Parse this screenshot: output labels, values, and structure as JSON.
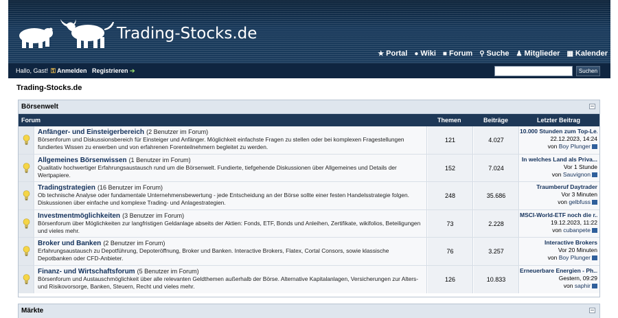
{
  "header": {
    "site_title": "Trading-Stocks.de",
    "menu": [
      {
        "label": "Portal",
        "icon": "portal-icon",
        "glyph": "★"
      },
      {
        "label": "Wiki",
        "icon": "wiki-icon",
        "glyph": "●"
      },
      {
        "label": "Forum",
        "icon": "forum-icon",
        "glyph": "■"
      },
      {
        "label": "Suche",
        "icon": "search-icon",
        "glyph": "⚲"
      },
      {
        "label": "Mitglieder",
        "icon": "members-icon",
        "glyph": "♟"
      },
      {
        "label": "Kalender",
        "icon": "calendar-icon",
        "glyph": "▦"
      }
    ]
  },
  "userbar": {
    "greeting": "Hallo, Gast!",
    "login": "Anmelden",
    "register": "Registrieren",
    "search_placeholder": "",
    "search_button": "Suchen"
  },
  "breadcrumb": "Trading-Stocks.de",
  "category": {
    "title": "Börsenwelt",
    "columns": {
      "forum": "Forum",
      "themen": "Themen",
      "beitraege": "Beiträge",
      "last": "Letzter Beitrag"
    },
    "forums": [
      {
        "title": "Anfänger- und Einsteigerbereich",
        "users": "(2 Benutzer im Forum)",
        "desc": "Börsenforum und Diskussionsbereich für Einsteiger und Anfänger. Möglichkeit einfachste Fragen zu stellen oder bei komplexen Fragestellungen fundiertes Wissen zu erwerben und von erfahrenen Forenteilnehmern begleitet zu werden.",
        "themen": "121",
        "beitraege": "4.027",
        "last_title": "10.000 Stunden zum Top-Le...",
        "last_time": "22.12.2023, 14:24",
        "last_by": "von",
        "last_user": "Boy Plunger"
      },
      {
        "title": "Allgemeines Börsenwissen",
        "users": "(1 Benutzer im Forum)",
        "desc": "Qualitativ hochwertiger Erfahrungsaustausch rund um die Börsenwelt. Fundierte, tiefgehende Diskussionen über Allgemeines und Details der Wertpapiere.",
        "themen": "152",
        "beitraege": "7.024",
        "last_title": "In welches Land als Priva...",
        "last_time": "Vor 1 Stunde",
        "last_by": "von",
        "last_user": "Sauvignon"
      },
      {
        "title": "Tradingstrategien",
        "users": "(16 Benutzer im Forum)",
        "desc": "Ob technische Analyse oder fundamentale Unternehmensbewertung - jede Entscheidung an der Börse sollte einer festen Handelsstrategie folgen. Diskussionen über einfache und komplexe Trading- und Anlagestrategien.",
        "themen": "248",
        "beitraege": "35.686",
        "last_title": "Traumberuf Daytrader",
        "last_time": "Vor 3 Minuten",
        "last_by": "von",
        "last_user": "gelbfuss"
      },
      {
        "title": "Investmentmöglichkeiten",
        "users": "(3 Benutzer im Forum)",
        "desc": "Börsenforum über Möglichkeiten zur langfristigen Geldanlage abseits der Aktien: Fonds, ETF, Bonds und Anleihen, Zertifikate, wikifolios, Beteiligungen und vieles mehr.",
        "themen": "73",
        "beitraege": "2.228",
        "last_title": "MSCI-World-ETF noch die r...",
        "last_time": "19.12.2023, 11:22",
        "last_by": "von",
        "last_user": "cubanpete"
      },
      {
        "title": "Broker und Banken",
        "users": "(2 Benutzer im Forum)",
        "desc": "Erfahrungsaustausch zu Depotführung, Depoteröffnung, Broker und Banken. Interactive Brokers, Flatex, Cortal Consors, sowie klassische Depotbanken oder CFD-Anbieter.",
        "themen": "76",
        "beitraege": "3.257",
        "last_title": "Interactive Brokers",
        "last_time": "Vor 20 Minuten",
        "last_by": "von",
        "last_user": "Boy Plunger"
      },
      {
        "title": "Finanz- und Wirtschaftsforum",
        "users": "(5 Benutzer im Forum)",
        "desc": "Börsenforum und Austauschmöglichkeit über alle relevanten Geldthemen außerhalb der Börse. Alternative Kapitalanlagen, Versicherungen zur Alters- und Risikovorsorge, Banken, Steuern, Recht und vieles mehr.",
        "themen": "126",
        "beitraege": "10.833",
        "last_title": "Erneuerbare Energien - Ph...",
        "last_time": "Gestern, 09:29",
        "last_by": "von",
        "last_user": "saphir"
      }
    ]
  },
  "category2": {
    "title": "Märkte"
  }
}
